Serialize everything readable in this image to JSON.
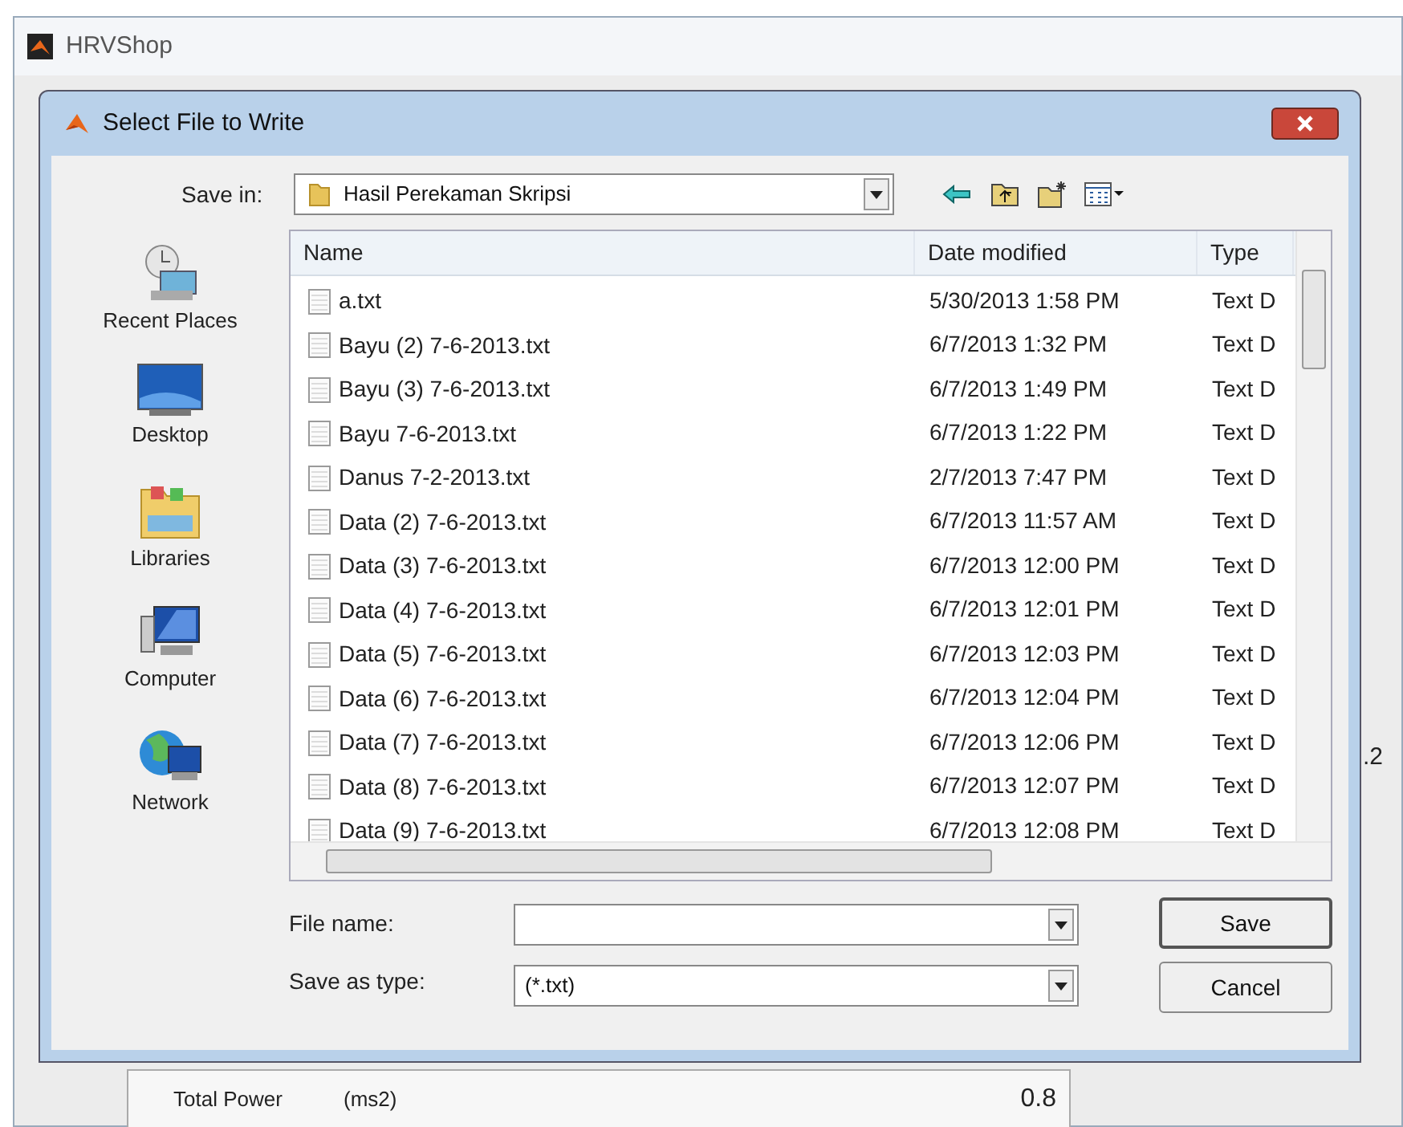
{
  "app_window": {
    "title": "HRVShop",
    "behind": {
      "axis_label": ".2",
      "table_row": {
        "label": "Total Power",
        "unit": "(ms2)",
        "value": "0.8"
      }
    }
  },
  "dialog": {
    "title": "Select File to Write",
    "save_in": {
      "label": "Save in:",
      "value": "Hasil Perekaman Skripsi"
    },
    "places": [
      {
        "label": "Recent Places",
        "kind": "recent"
      },
      {
        "label": "Desktop",
        "kind": "desktop"
      },
      {
        "label": "Libraries",
        "kind": "libraries"
      },
      {
        "label": "Computer",
        "kind": "computer"
      },
      {
        "label": "Network",
        "kind": "network"
      }
    ],
    "columns": [
      "Name",
      "Date modified",
      "Type"
    ],
    "files": [
      {
        "name": "a.txt",
        "date": "5/30/2013 1:58 PM",
        "type": "Text D"
      },
      {
        "name": "Bayu (2) 7-6-2013.txt",
        "date": "6/7/2013 1:32 PM",
        "type": "Text D"
      },
      {
        "name": "Bayu (3) 7-6-2013.txt",
        "date": "6/7/2013 1:49 PM",
        "type": "Text D"
      },
      {
        "name": "Bayu 7-6-2013.txt",
        "date": "6/7/2013 1:22 PM",
        "type": "Text D"
      },
      {
        "name": "Danus 7-2-2013.txt",
        "date": "2/7/2013 7:47 PM",
        "type": "Text D"
      },
      {
        "name": "Data (2) 7-6-2013.txt",
        "date": "6/7/2013 11:57 AM",
        "type": "Text D"
      },
      {
        "name": "Data (3) 7-6-2013.txt",
        "date": "6/7/2013 12:00 PM",
        "type": "Text D"
      },
      {
        "name": "Data (4) 7-6-2013.txt",
        "date": "6/7/2013 12:01 PM",
        "type": "Text D"
      },
      {
        "name": "Data (5) 7-6-2013.txt",
        "date": "6/7/2013 12:03 PM",
        "type": "Text D"
      },
      {
        "name": "Data (6) 7-6-2013.txt",
        "date": "6/7/2013 12:04 PM",
        "type": "Text D"
      },
      {
        "name": "Data (7) 7-6-2013.txt",
        "date": "6/7/2013 12:06 PM",
        "type": "Text D"
      },
      {
        "name": "Data (8) 7-6-2013.txt",
        "date": "6/7/2013 12:07 PM",
        "type": "Text D"
      },
      {
        "name": "Data (9) 7-6-2013.txt",
        "date": "6/7/2013 12:08 PM",
        "type": "Text D"
      }
    ],
    "file_name": {
      "label": "File name:"
    },
    "save_as_type": {
      "label": "Save as type:",
      "value": "(*.txt)"
    },
    "buttons": [
      "Save",
      "Cancel"
    ]
  }
}
